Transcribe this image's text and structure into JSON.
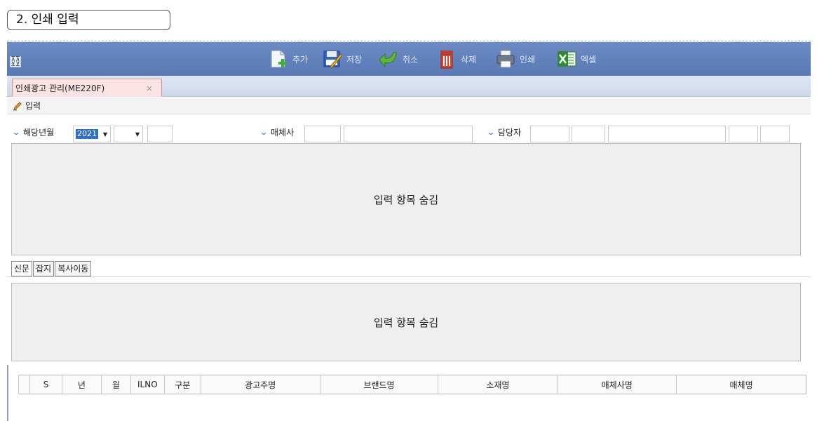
{
  "page_title": "2. 인쇄 입력",
  "toolbar": {
    "buttons": [
      {
        "label": "추가",
        "icon": "add-document-icon"
      },
      {
        "label": "저장",
        "icon": "save-icon"
      },
      {
        "label": "취소",
        "icon": "undo-icon"
      },
      {
        "label": "삭제",
        "icon": "trash-icon"
      },
      {
        "label": "인쇄",
        "icon": "printer-icon"
      },
      {
        "label": "엑셀",
        "icon": "excel-icon"
      }
    ]
  },
  "tab": {
    "label": "인쇄광고 관리(ME220F)",
    "close": "×"
  },
  "input_bar": {
    "label": "입력"
  },
  "filters": {
    "year_month_label": "해당년월",
    "year_value": "2021",
    "media_company_label": "매체사",
    "manager_label": "담당자"
  },
  "panel": {
    "hidden_text": "입력 항목 숨김"
  },
  "subtabs": [
    "신문",
    "잡지",
    "복사이동"
  ],
  "subpanel": {
    "hidden_text": "입력 항목 숨김"
  },
  "grid": {
    "columns": [
      "S",
      "년",
      "월",
      "ILNO",
      "구분",
      "광고주명",
      "브랜드명",
      "소재명",
      "매체사명",
      "매체명"
    ]
  },
  "colors": {
    "toolbar": "#5f80bb",
    "tab_active": "#fbe3e3",
    "accent_blue": "#2f6fd0"
  }
}
